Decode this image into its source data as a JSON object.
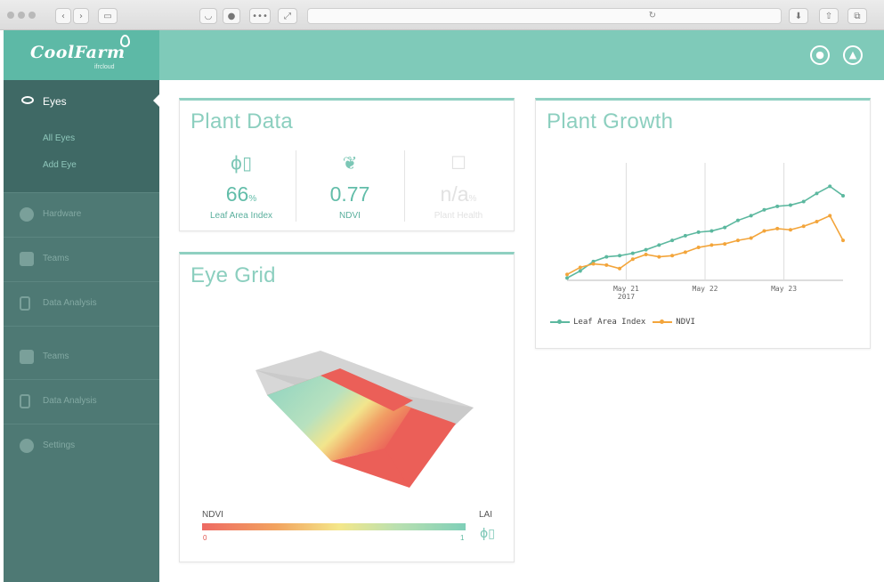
{
  "app": {
    "logo": "CoolFarm",
    "logo_sub": "ifrcloud"
  },
  "header": {
    "user_icon": "user-icon",
    "bell_icon": "bell-icon"
  },
  "sidebar": {
    "active": {
      "label": "Eyes",
      "icon": "eye-icon"
    },
    "sub_items": [
      "All Eyes",
      "Add Eye"
    ],
    "items": [
      {
        "label": "Hardware",
        "icon": "hardware-icon"
      },
      {
        "label": "Teams",
        "icon": "teams-icon"
      },
      {
        "label": "Data Analysis",
        "icon": "document-icon"
      },
      {
        "label": "Teams",
        "icon": "teams-icon"
      },
      {
        "label": "Data Analysis",
        "icon": "document-icon"
      },
      {
        "label": "Settings",
        "icon": "gear-icon"
      }
    ]
  },
  "plant_data": {
    "title": "Plant Data",
    "metrics": [
      {
        "value": "66",
        "unit": "%",
        "label": "Leaf Area Index",
        "icon": "leaf-ruler-icon"
      },
      {
        "value": "0.77",
        "unit": "",
        "label": "NDVI",
        "icon": "sprout-icon"
      },
      {
        "value": "n/a",
        "unit": "%",
        "label": "Plant Health",
        "icon": "plant-health-icon"
      }
    ]
  },
  "eye_grid": {
    "title": "Eye Grid",
    "left_label": "NDVI",
    "right_label": "LAI",
    "min": "0",
    "max": "1"
  },
  "plant_growth": {
    "title": "Plant Growth"
  },
  "chart_data": {
    "type": "line",
    "title": "Plant Growth",
    "x_ticks": [
      "May 21\n2017",
      "May 22",
      "May 23"
    ],
    "series": [
      {
        "name": "Leaf Area Index",
        "color": "#5cb89f",
        "values": [
          0.02,
          0.08,
          0.16,
          0.2,
          0.21,
          0.23,
          0.26,
          0.3,
          0.34,
          0.38,
          0.41,
          0.42,
          0.45,
          0.51,
          0.55,
          0.6,
          0.63,
          0.64,
          0.67,
          0.74,
          0.8,
          0.72
        ]
      },
      {
        "name": "NDVI",
        "color": "#f3a53b",
        "values": [
          0.05,
          0.11,
          0.14,
          0.13,
          0.1,
          0.18,
          0.22,
          0.2,
          0.21,
          0.24,
          0.28,
          0.3,
          0.31,
          0.34,
          0.36,
          0.42,
          0.44,
          0.43,
          0.46,
          0.5,
          0.55,
          0.34
        ]
      }
    ],
    "grid": "vertical",
    "legend": "bottom-left"
  },
  "colors": {
    "accent": "#7fcab9",
    "sidebar": "#4e7974",
    "lai": "#5cb89f",
    "ndvi": "#f3a53b"
  }
}
